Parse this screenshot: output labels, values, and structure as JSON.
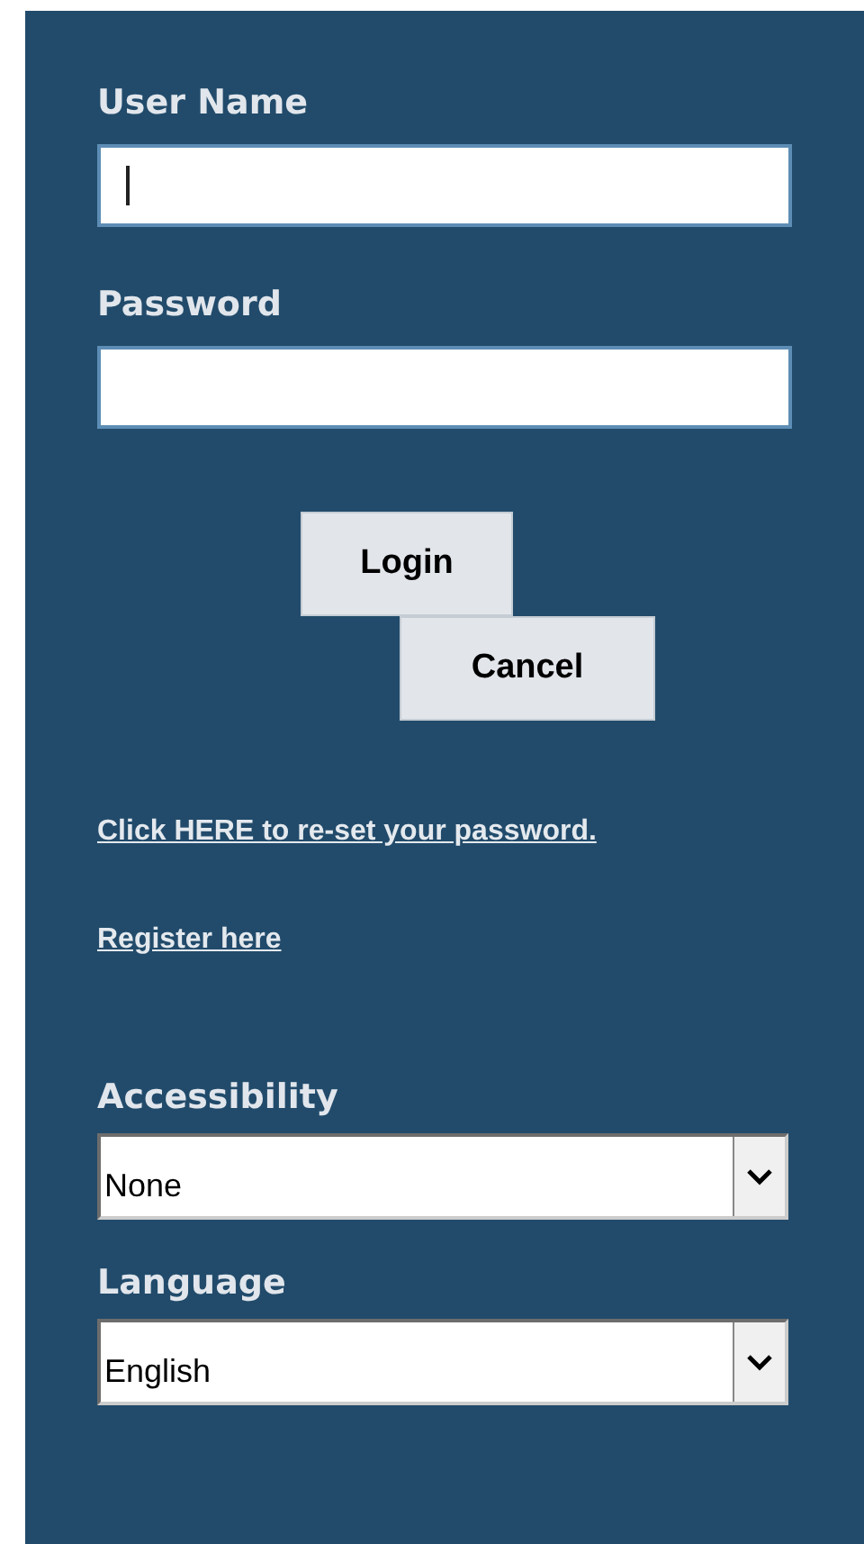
{
  "fields": [
    {
      "label": "User Name",
      "focused": true
    },
    {
      "label": "Password",
      "focused": false
    }
  ],
  "buttons": [
    {
      "label": "Login",
      "kind": "login"
    },
    {
      "label": "Cancel",
      "kind": "cancel"
    }
  ],
  "links": [
    "Click HERE to re-set your password.",
    "Register here"
  ],
  "selects": [
    {
      "label": "Accessibility",
      "value": "None"
    },
    {
      "label": "Language",
      "value": "English"
    }
  ]
}
